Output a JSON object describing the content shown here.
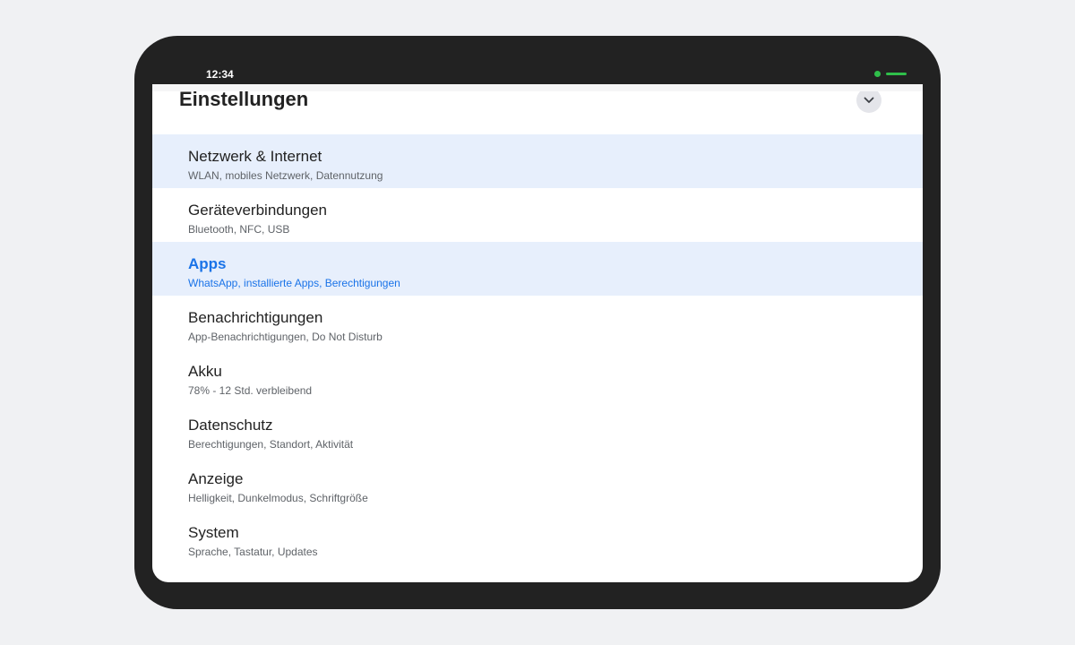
{
  "status_bar": {
    "time": "12:34",
    "indicator_color": "#2fbf4a"
  },
  "header": {
    "title": "Einstellungen",
    "collapse_icon": "chevron-down-icon"
  },
  "colors": {
    "accent": "#1a73e8",
    "highlight": "#e7effc"
  },
  "items": [
    {
      "title": "Netzwerk & Internet",
      "subtitle": "WLAN, mobiles Netzwerk, Datennutzung"
    },
    {
      "title": "Geräteverbindungen",
      "subtitle": "Bluetooth, NFC, USB"
    },
    {
      "title": "Apps",
      "subtitle": "WhatsApp, installierte Apps, Berechtigungen"
    },
    {
      "title": "Benachrichtigungen",
      "subtitle": "App-Benachrichtigungen, Do Not Disturb"
    },
    {
      "title": "Akku",
      "subtitle": "78% - 12 Std. verbleibend"
    },
    {
      "title": "Datenschutz",
      "subtitle": "Berechtigungen, Standort, Aktivität"
    },
    {
      "title": "Anzeige",
      "subtitle": "Helligkeit, Dunkelmodus, Schriftgröße"
    },
    {
      "title": "System",
      "subtitle": "Sprache, Tastatur, Updates"
    }
  ]
}
